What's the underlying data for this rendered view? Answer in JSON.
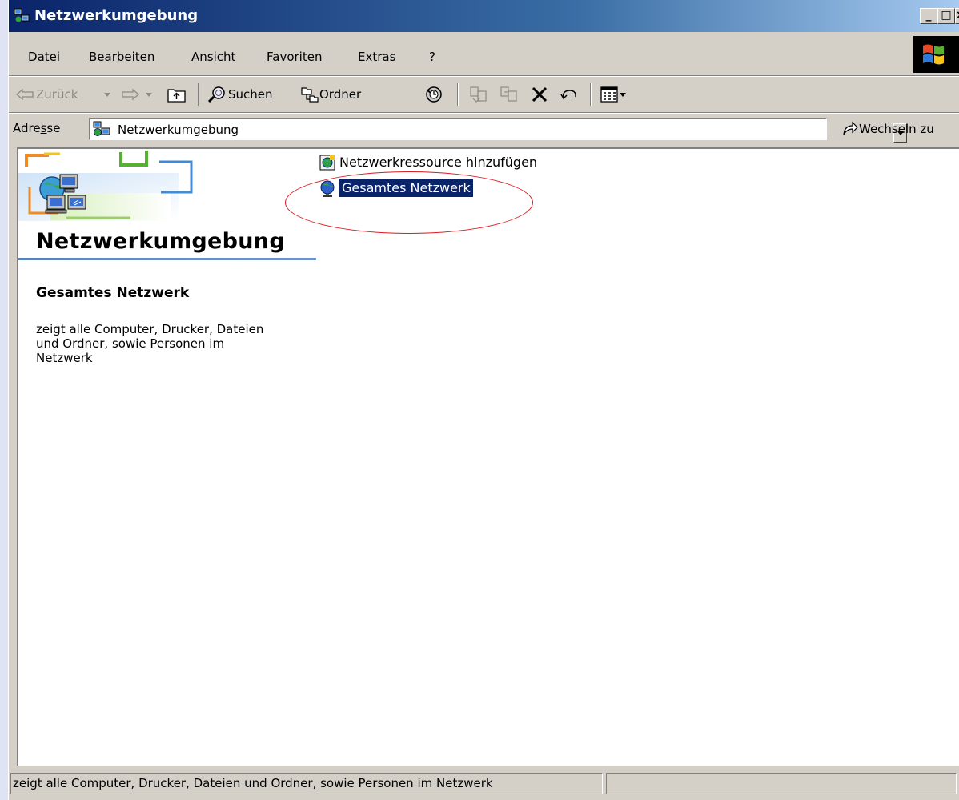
{
  "window": {
    "title": "Netzwerkumgebung",
    "controls": [
      "minimize",
      "maximize",
      "close"
    ],
    "min_label": "_",
    "max_label": "□",
    "close_label": "×"
  },
  "menu": {
    "items": [
      {
        "label": "Datei",
        "accel": "D"
      },
      {
        "label": "Bearbeiten",
        "accel": "B"
      },
      {
        "label": "Ansicht",
        "accel": "A"
      },
      {
        "label": "Favoriten",
        "accel": "F"
      },
      {
        "label": "Extras",
        "accel": "x"
      },
      {
        "label": "?",
        "accel": "?"
      }
    ]
  },
  "toolbar": {
    "back_label": "Zurück",
    "search_label": "Suchen",
    "folders_label": "Ordner"
  },
  "address": {
    "label_pre": "Adre",
    "label_accel": "s",
    "label_post": "se",
    "value": "Netzwerkumgebung",
    "goto_label": "Wechseln zu"
  },
  "content": {
    "folder_title": "Netzwerkumgebung",
    "selected_title": "Gesamtes Netzwerk",
    "selected_description": "zeigt alle Computer, Drucker, Dateien\nund Ordner, sowie Personen im\nNetzwerk",
    "items": [
      {
        "label": "Netzwerkressource hinzufügen",
        "icon": "add-network-place-icon",
        "selected": false
      },
      {
        "label": "Gesamtes Netzwerk",
        "icon": "globe-network-icon",
        "selected": true
      }
    ]
  },
  "status": {
    "text": "zeigt alle Computer, Drucker, Dateien und Ordner, sowie Personen im Netzwerk"
  },
  "colors": {
    "titlebar": "#0a246a",
    "selection": "#0a246a",
    "annotation": "#d8191f",
    "chrome": "#d4d0c8"
  }
}
